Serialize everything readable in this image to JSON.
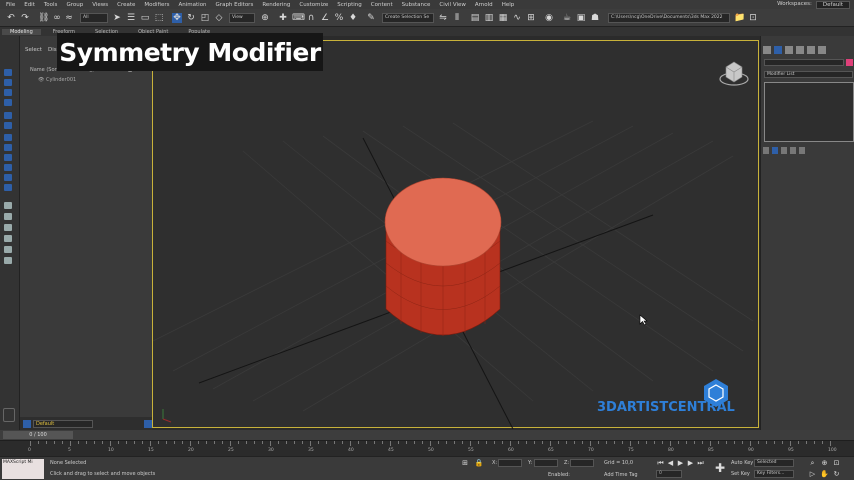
{
  "menu": [
    "File",
    "Edit",
    "Tools",
    "Group",
    "Views",
    "Create",
    "Modifiers",
    "Animation",
    "Graph Editors",
    "Rendering",
    "Customize",
    "Scripting",
    "Content",
    "Substance",
    "Civil View",
    "Arnold",
    "Help"
  ],
  "workspaces": {
    "label": "Workspaces:",
    "value": "Default"
  },
  "toolbar": {
    "selection_filter": "All",
    "ref_coord": "View",
    "named_selection": "Create Selection Se",
    "project_path": "C:\\Users\\ncg\\OneDrive\\Documents\\3ds Max 2022"
  },
  "ribbon_tabs": [
    "Modeling",
    "Freeform",
    "Selection",
    "Object Paint",
    "Populate"
  ],
  "overlay_title": "Symmetry Modifier",
  "scene_explorer": {
    "tabs": [
      "Select",
      "Display"
    ],
    "header_name": "Name (Sorted Ascending)",
    "header_frozen": "▲ Frozen",
    "row": "Cylinder001",
    "layer": "Default"
  },
  "command_panel": {
    "modifier_list": "Modifier List"
  },
  "timeline": {
    "frame_indicator": "0 / 100",
    "ticks": [
      "0",
      "5",
      "10",
      "15",
      "20",
      "25",
      "30",
      "35",
      "40",
      "45",
      "50",
      "55",
      "60",
      "65",
      "70",
      "75",
      "80",
      "85",
      "90",
      "95",
      "100"
    ]
  },
  "status": {
    "maxscript": "MAXScript Mi",
    "selection": "None Selected",
    "prompt": "Click and drag to select and move objects",
    "x_label": "X:",
    "y_label": "Y:",
    "z_label": "Z:",
    "grid": "Grid = 10,0",
    "enabled": "Enabled:",
    "add_time_tag": "Add Time Tag",
    "auto_key": "Auto Key",
    "selected": "Selected",
    "set_key": "Set Key",
    "key_filters": "Key Filters...",
    "frame_value": "0"
  },
  "watermark": "3DARTISTCENTRAL",
  "colors": {
    "cylinder_top": "#e06a52",
    "cylinder_side": "#b8321f",
    "viewport_border": "#c8b23a",
    "accent_blue": "#2e7fd8"
  }
}
